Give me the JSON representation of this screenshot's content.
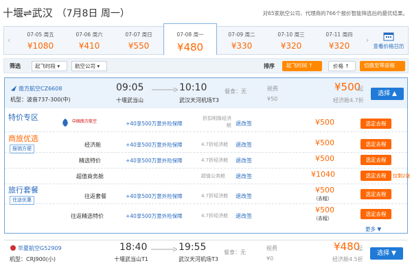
{
  "header": {
    "route": "十堰⇌武汉",
    "date": "（7月8日 周一）",
    "note": "对65家航空公司、代理商的766个报价智能筛选后的最优结果。"
  },
  "dates": [
    {
      "label": "07-05 周五",
      "price": "¥1080"
    },
    {
      "label": "07-06 周六",
      "price": "¥410"
    },
    {
      "label": "07-07 周日",
      "price": "¥550"
    },
    {
      "label": "07-08 周一",
      "price": "¥480"
    },
    {
      "label": "07-09 周二",
      "price": "¥330"
    },
    {
      "label": "07-10 周三",
      "price": "¥320"
    },
    {
      "label": "07-11 周四",
      "price": "¥320"
    }
  ],
  "calendar_label": "查看价格日历",
  "filters": {
    "title": "筛选",
    "depart": "起飞时段",
    "airline": "航空公司",
    "sort_title": "排序",
    "sort_time": "起飞时间 ↑",
    "sort_price": "价格 ↑",
    "switch": "切换至带返程"
  },
  "flight1": {
    "airline": "南方航空CZ6608",
    "model": "机型：波音737-300(中)",
    "dep_time": "09:05",
    "dep_airport": "十堰武当山",
    "arr_time": "10:10",
    "arr_airport": "武汉天河机场T3",
    "meal": "餐食：无",
    "tax": "税费",
    "tax_val": "¥50",
    "price": "¥500",
    "price_unit": "起",
    "discount": "经济舱4.7折",
    "select": "选择 ▲"
  },
  "fare_rows": [
    {
      "section": "特价专区",
      "logo": "中国南方航空",
      "ins": "+40享500万意外险保障",
      "cabin": "折扣明珠经济舱",
      "rule": "退改签",
      "price": "¥500",
      "btn": "选定去程"
    },
    {
      "section": "商旅优选",
      "sub_tag": "报销方便",
      "name": "经济舱",
      "ins": "+40享500万意外险保障",
      "cabin": "4.7折经济舱",
      "rule": "退改签",
      "price": "¥500",
      "btn": "选定去程"
    },
    {
      "name": "精选特价",
      "ins": "+40享500万意外险保障",
      "cabin": "4.7折经济舱",
      "rule": "退改签",
      "price": "¥500",
      "btn": "选定去程"
    },
    {
      "name": "超值商务舱",
      "ins": "",
      "cabin": "超值公务舱",
      "rule": "退改签",
      "price": "¥1040",
      "btn": "选定去程",
      "extra": "仅剩2张"
    },
    {
      "section": "旅行套餐",
      "sub_tag": "住送优惠",
      "name": "往返套餐",
      "ins": "+40享500万意外险保障",
      "cabin": "4.7折经济舱",
      "rule": "退改签",
      "price": "¥500",
      "price_note": "（去程）",
      "btn": "选定去程"
    },
    {
      "name": "往返精选特价",
      "ins": "+40享500万意外险保障",
      "cabin": "4.7折经济舱",
      "rule": "退改签",
      "price": "¥500",
      "price_note": "（去程）",
      "btn": "选定去程"
    }
  ],
  "more": "更多 ▼",
  "flight2": {
    "airline": "华夏航空G52909",
    "model": "机型：CRJ900(小)",
    "dep_time": "18:40",
    "dep_airport": "十堰武当山T1",
    "arr_time": "19:55",
    "arr_airport": "武汉天河机场T3",
    "meal": "餐食：无",
    "tax": "税费",
    "tax_val": "¥0",
    "price": "¥480",
    "price_unit": "起",
    "discount": "经济舱4.5折",
    "select": "选择 ▼"
  }
}
